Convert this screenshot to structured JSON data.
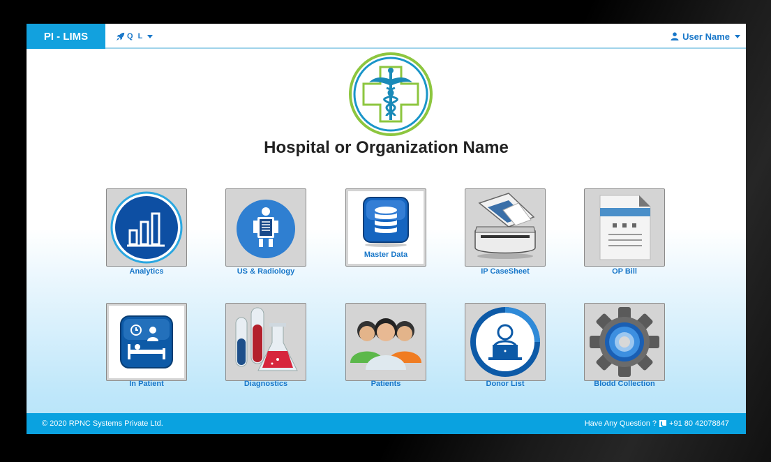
{
  "header": {
    "brand": "PI - LIMS",
    "quick_links": "Q L",
    "user_name": "User Name"
  },
  "org": {
    "name": "Hospital or Organization Name"
  },
  "tiles": [
    {
      "label": "Analytics",
      "icon": "analytics-icon"
    },
    {
      "label": "US & Radiology",
      "icon": "radiology-icon"
    },
    {
      "label": "Master Data",
      "icon": "database-icon"
    },
    {
      "label": "IP CaseSheet",
      "icon": "scanner-icon"
    },
    {
      "label": "OP Bill",
      "icon": "bill-document-icon"
    },
    {
      "label": "In Patient",
      "icon": "hospital-bed-icon"
    },
    {
      "label": "Diagnostics",
      "icon": "test-tubes-icon"
    },
    {
      "label": "Patients",
      "icon": "people-group-icon"
    },
    {
      "label": "Donor List",
      "icon": "person-laptop-icon"
    },
    {
      "label": "Blodd Collection",
      "icon": "gear-icon"
    }
  ],
  "footer": {
    "copyright": "© 2020 RPNC Systems Private Ltd.",
    "question": "Have Any Question ?",
    "phone": "+91 80 42078847"
  },
  "colors": {
    "brand_blue": "#12a1de",
    "link_blue": "#1877c9",
    "footer_blue": "#0aa2e0",
    "tile_bg": "#d4d4d4"
  }
}
